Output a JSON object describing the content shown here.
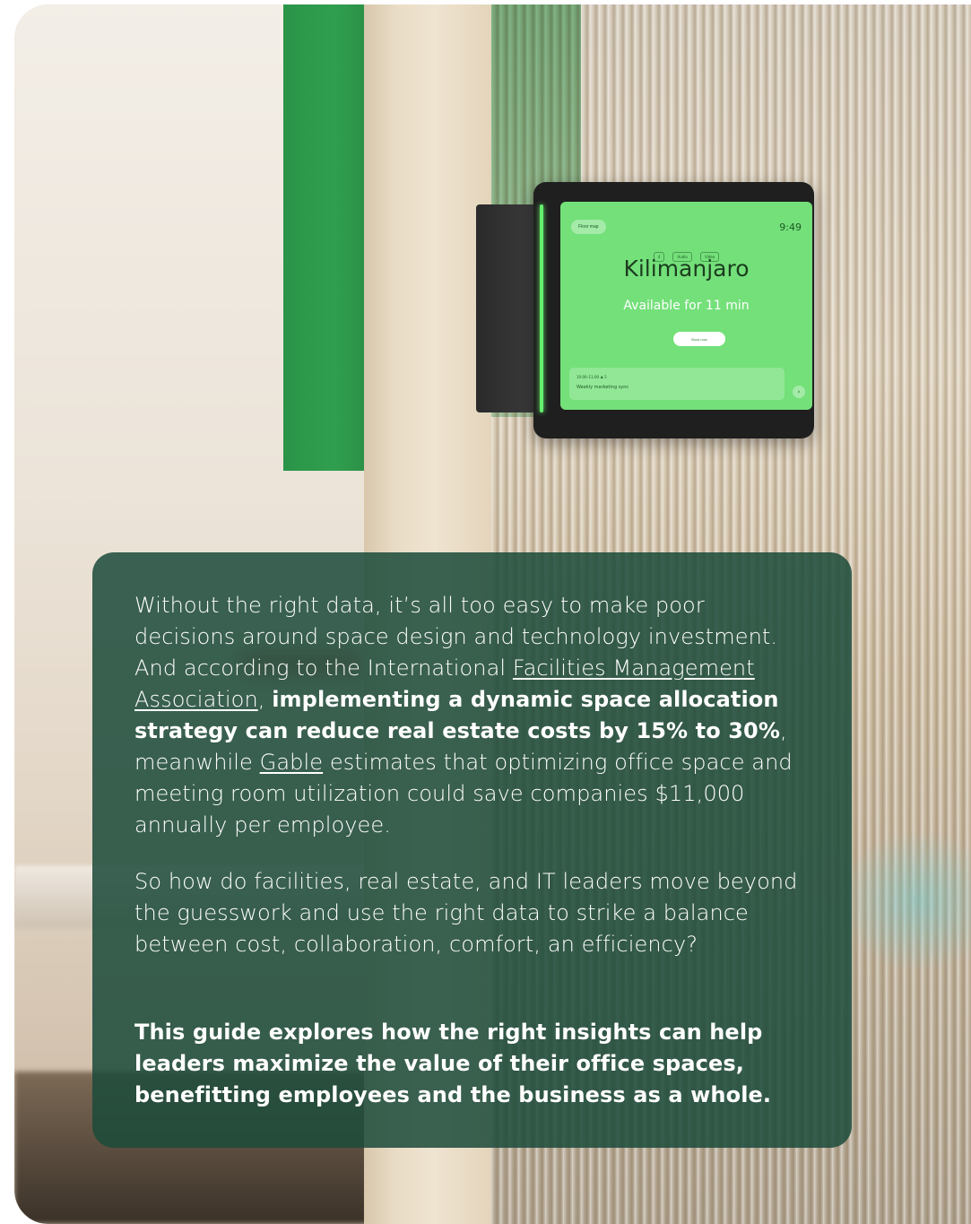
{
  "tablet": {
    "floor_map_label": "Floor map",
    "time": "9:49",
    "amenities": [
      "4",
      "Audio",
      "Video"
    ],
    "room_name": "Kilimanjaro",
    "availability": "Available for 11 min",
    "book_label": "Book now",
    "meeting_time": "10:00–11:00   ♟ 5",
    "meeting_title": "Weekly marketing sync",
    "next_icon": "chevron-right-icon"
  },
  "paragraph1": {
    "s1": "Without the right data, it’s all too easy to make poor decisions around space design and technology investment. And according to the International ",
    "link1": "Facilities Management Association",
    "s2": ", ",
    "bold1": "implementing a dynamic space allocation strategy can reduce real estate costs by 15% to 30%",
    "s3": ", meanwhile ",
    "link2": "Gable",
    "s4": " estimates that optimizing office space and meeting room utilization could save companies $11,000 annually per employee."
  },
  "paragraph2": "So how do facilities, real estate, and IT leaders move beyond the guesswork and use the right data to strike a balance between cost, collaboration, comfort, an efficiency?",
  "paragraph3": "This guide explores how the right insights can help leaders maximize the value of their office spaces, benefitting employees and the business as a whole.",
  "colors": {
    "panel": "#1c4a3a",
    "screen": "#74e07a",
    "sign": "#2f9f4e"
  }
}
